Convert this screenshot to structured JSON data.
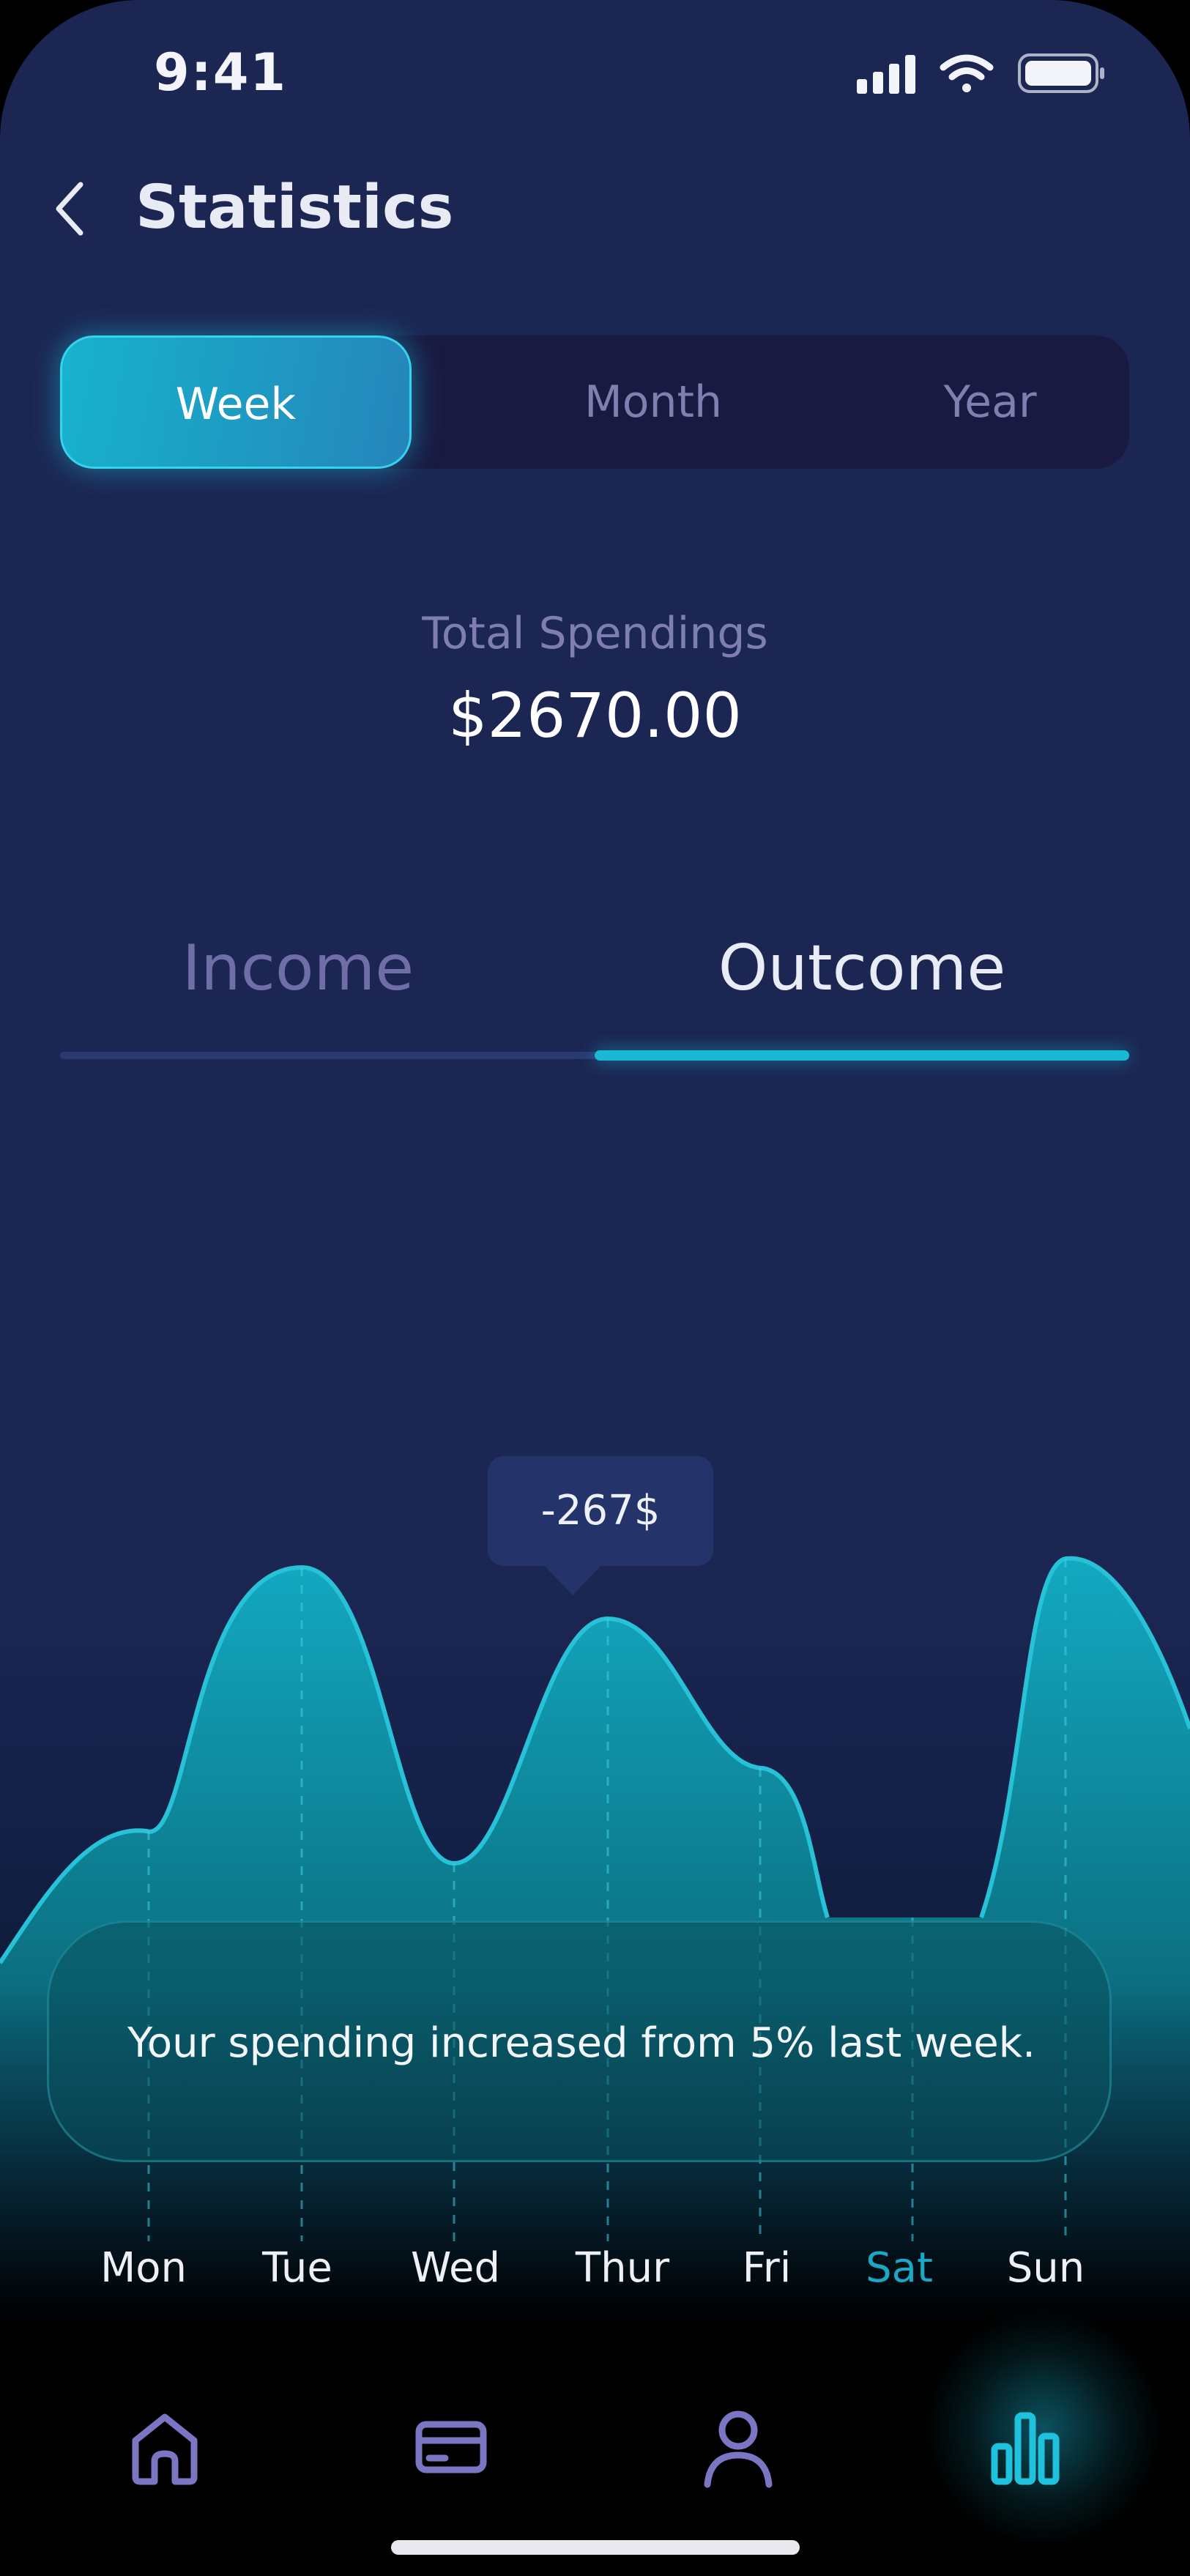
{
  "status_bar": {
    "time": "9:41"
  },
  "header": {
    "title": "Statistics"
  },
  "period_tabs": {
    "week": "Week",
    "month": "Month",
    "year": "Year",
    "selected": "Week"
  },
  "summary": {
    "label": "Total Spendings",
    "value": "$2670.00"
  },
  "flow_tabs": {
    "income": "Income",
    "outcome": "Outcome",
    "selected": "Outcome"
  },
  "chart_data": {
    "type": "area",
    "categories": [
      "Mon",
      "Tue",
      "Wed",
      "Thur",
      "Fri",
      "Sat",
      "Sun"
    ],
    "selected_category": "Sat",
    "tooltip": "-267$",
    "colors": {
      "fill_top": "#13a9c2",
      "fill_bottom": "#0a5566",
      "stroke": "#27c1d8"
    }
  },
  "insight": {
    "text": "Your spending increased from 5% last week."
  },
  "bottom_nav": {
    "items": [
      {
        "icon": "home-icon",
        "active": false
      },
      {
        "icon": "card-icon",
        "active": false
      },
      {
        "icon": "profile-icon",
        "active": false
      },
      {
        "icon": "stats-icon",
        "active": true
      }
    ],
    "accent": "#1ec2dc",
    "inactive": "#7a76c2"
  }
}
